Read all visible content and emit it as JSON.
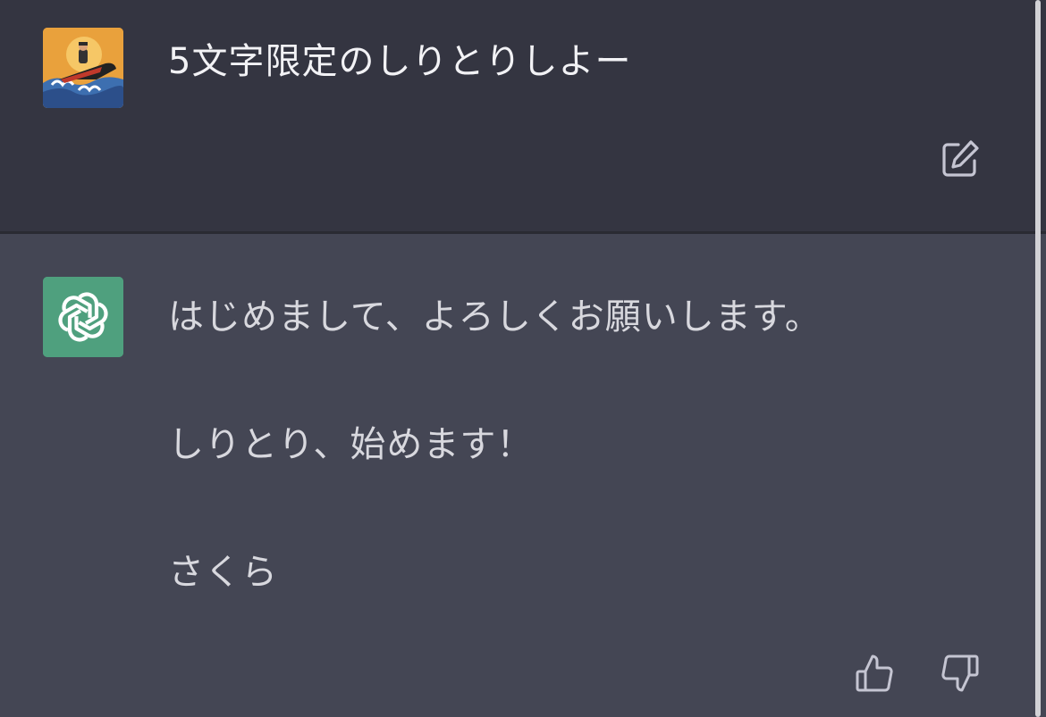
{
  "conversation": {
    "user_message": {
      "text": "5文字限定のしりとりしよー",
      "avatar_icon": "jetski-rider-avatar",
      "edit_icon": "edit-icon"
    },
    "assistant_message": {
      "avatar_icon": "openai-logo-icon",
      "paragraphs": [
        "はじめまして、よろしくお願いします。",
        "しりとり、始めます！",
        "さくら"
      ],
      "feedback_icons": [
        "thumbs-up-icon",
        "thumbs-down-icon"
      ]
    }
  },
  "colors": {
    "user_bg": "#343541",
    "assistant_bg": "#444654",
    "gpt_avatar_bg": "#4fa07e",
    "text": "#ececf1"
  }
}
